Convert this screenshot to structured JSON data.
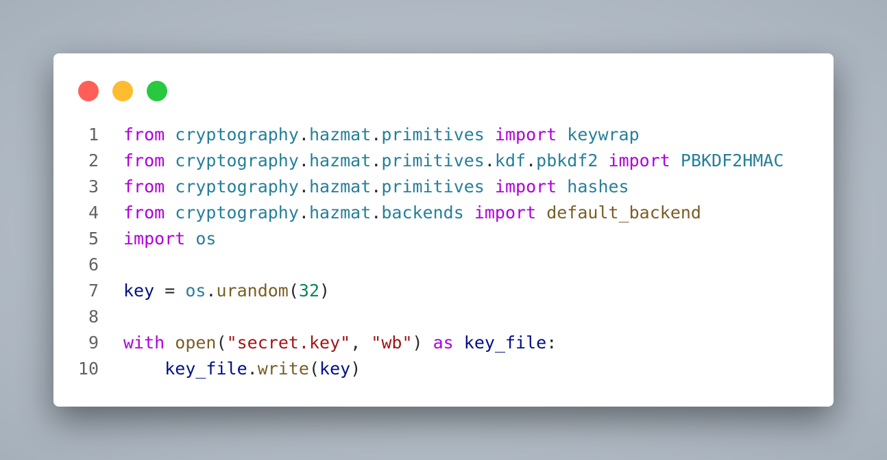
{
  "window": {
    "controls": {
      "close_color": "#ff5f57",
      "minimize_color": "#febc2e",
      "maximize_color": "#28c840"
    }
  },
  "code": {
    "language": "python",
    "lines": [
      {
        "number": "1",
        "tokens": [
          {
            "t": "from",
            "k": "kw"
          },
          {
            "t": " ",
            "k": "op"
          },
          {
            "t": "cryptography",
            "k": "mod"
          },
          {
            "t": ".",
            "k": "op"
          },
          {
            "t": "hazmat",
            "k": "mod"
          },
          {
            "t": ".",
            "k": "op"
          },
          {
            "t": "primitives",
            "k": "mod"
          },
          {
            "t": " ",
            "k": "op"
          },
          {
            "t": "import",
            "k": "kw"
          },
          {
            "t": " ",
            "k": "op"
          },
          {
            "t": "keywrap",
            "k": "mod"
          }
        ]
      },
      {
        "number": "2",
        "tokens": [
          {
            "t": "from",
            "k": "kw"
          },
          {
            "t": " ",
            "k": "op"
          },
          {
            "t": "cryptography",
            "k": "mod"
          },
          {
            "t": ".",
            "k": "op"
          },
          {
            "t": "hazmat",
            "k": "mod"
          },
          {
            "t": ".",
            "k": "op"
          },
          {
            "t": "primitives",
            "k": "mod"
          },
          {
            "t": ".",
            "k": "op"
          },
          {
            "t": "kdf",
            "k": "mod"
          },
          {
            "t": ".",
            "k": "op"
          },
          {
            "t": "pbkdf2",
            "k": "mod"
          },
          {
            "t": " ",
            "k": "op"
          },
          {
            "t": "import",
            "k": "kw"
          },
          {
            "t": " ",
            "k": "op"
          },
          {
            "t": "PBKDF2HMAC",
            "k": "mod"
          }
        ]
      },
      {
        "number": "3",
        "tokens": [
          {
            "t": "from",
            "k": "kw"
          },
          {
            "t": " ",
            "k": "op"
          },
          {
            "t": "cryptography",
            "k": "mod"
          },
          {
            "t": ".",
            "k": "op"
          },
          {
            "t": "hazmat",
            "k": "mod"
          },
          {
            "t": ".",
            "k": "op"
          },
          {
            "t": "primitives",
            "k": "mod"
          },
          {
            "t": " ",
            "k": "op"
          },
          {
            "t": "import",
            "k": "kw"
          },
          {
            "t": " ",
            "k": "op"
          },
          {
            "t": "hashes",
            "k": "mod"
          }
        ]
      },
      {
        "number": "4",
        "tokens": [
          {
            "t": "from",
            "k": "kw"
          },
          {
            "t": " ",
            "k": "op"
          },
          {
            "t": "cryptography",
            "k": "mod"
          },
          {
            "t": ".",
            "k": "op"
          },
          {
            "t": "hazmat",
            "k": "mod"
          },
          {
            "t": ".",
            "k": "op"
          },
          {
            "t": "backends",
            "k": "mod"
          },
          {
            "t": " ",
            "k": "op"
          },
          {
            "t": "import",
            "k": "kw"
          },
          {
            "t": " ",
            "k": "op"
          },
          {
            "t": "default_backend",
            "k": "fn"
          }
        ]
      },
      {
        "number": "5",
        "tokens": [
          {
            "t": "import",
            "k": "kw"
          },
          {
            "t": " ",
            "k": "op"
          },
          {
            "t": "os",
            "k": "mod"
          }
        ]
      },
      {
        "number": "6",
        "tokens": []
      },
      {
        "number": "7",
        "tokens": [
          {
            "t": "key",
            "k": "var"
          },
          {
            "t": " = ",
            "k": "op"
          },
          {
            "t": "os",
            "k": "mod"
          },
          {
            "t": ".",
            "k": "op"
          },
          {
            "t": "urandom",
            "k": "fn"
          },
          {
            "t": "(",
            "k": "op"
          },
          {
            "t": "32",
            "k": "num"
          },
          {
            "t": ")",
            "k": "op"
          }
        ]
      },
      {
        "number": "8",
        "tokens": []
      },
      {
        "number": "9",
        "tokens": [
          {
            "t": "with",
            "k": "kw"
          },
          {
            "t": " ",
            "k": "op"
          },
          {
            "t": "open",
            "k": "fn"
          },
          {
            "t": "(",
            "k": "op"
          },
          {
            "t": "\"secret.key\"",
            "k": "str"
          },
          {
            "t": ", ",
            "k": "op"
          },
          {
            "t": "\"wb\"",
            "k": "str"
          },
          {
            "t": ") ",
            "k": "op"
          },
          {
            "t": "as",
            "k": "kw"
          },
          {
            "t": " ",
            "k": "op"
          },
          {
            "t": "key_file",
            "k": "var"
          },
          {
            "t": ":",
            "k": "op"
          }
        ]
      },
      {
        "number": "10",
        "tokens": [
          {
            "t": "    ",
            "k": "op"
          },
          {
            "t": "key_file",
            "k": "var"
          },
          {
            "t": ".",
            "k": "op"
          },
          {
            "t": "write",
            "k": "fn"
          },
          {
            "t": "(",
            "k": "op"
          },
          {
            "t": "key",
            "k": "var"
          },
          {
            "t": ")",
            "k": "op"
          }
        ]
      }
    ]
  }
}
